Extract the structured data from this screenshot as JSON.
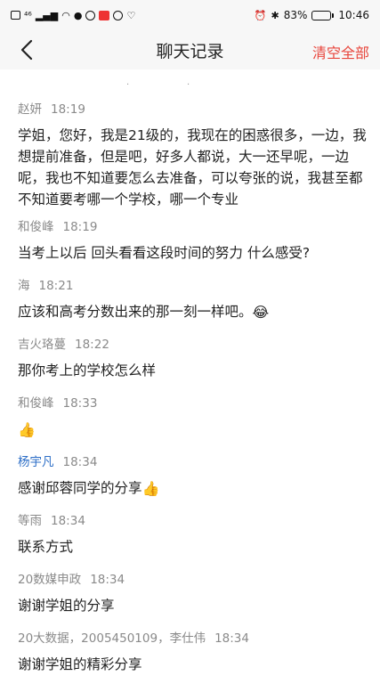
{
  "status_bar": {
    "signal": "⁴⁶",
    "battery": "83%",
    "battery_level": 0.83,
    "time": "10:46"
  },
  "nav": {
    "title": "聊天记录",
    "clear_label": "清空全部"
  },
  "messages": [
    {
      "sender": "赵妍",
      "time": "18:19",
      "text": "学姐，您好，我是21级的，我现在的困惑很多，一边，我想提前准备，但是吧，好多人都说，大一还早呢，一边呢，我也不知道要怎么去准备，可以夸张的说，我甚至都不知道要考哪一个学校，哪一个专业"
    },
    {
      "sender": "和俊峰",
      "time": "18:19",
      "text": "当考上以后 回头看看这段时间的努力 什么感受?"
    },
    {
      "sender": "海",
      "time": "18:21",
      "text": "应该和高考分数出来的那一刻一样吧。",
      "emoji": "😂"
    },
    {
      "sender": "吉火珞蔓",
      "time": "18:22",
      "text": "那你考上的学校怎么样"
    },
    {
      "sender": "和俊峰",
      "time": "18:33",
      "text": "",
      "emoji": "👍"
    },
    {
      "sender": "杨宇凡",
      "time": "18:34",
      "text": "感谢邱蓉同学的分享",
      "emoji": "👍",
      "highlight": true
    },
    {
      "sender": "等雨",
      "time": "18:34",
      "text": "联系方式"
    },
    {
      "sender": "20数媒申政",
      "time": "18:34",
      "text": "谢谢学姐的分享"
    },
    {
      "sender": "20大数据，2005450109，李仕伟",
      "time": "18:34",
      "text": "谢谢学姐的精彩分享"
    }
  ],
  "colors": {
    "accent_red": "#e8463c",
    "sender_highlight": "#2e6fc7"
  }
}
